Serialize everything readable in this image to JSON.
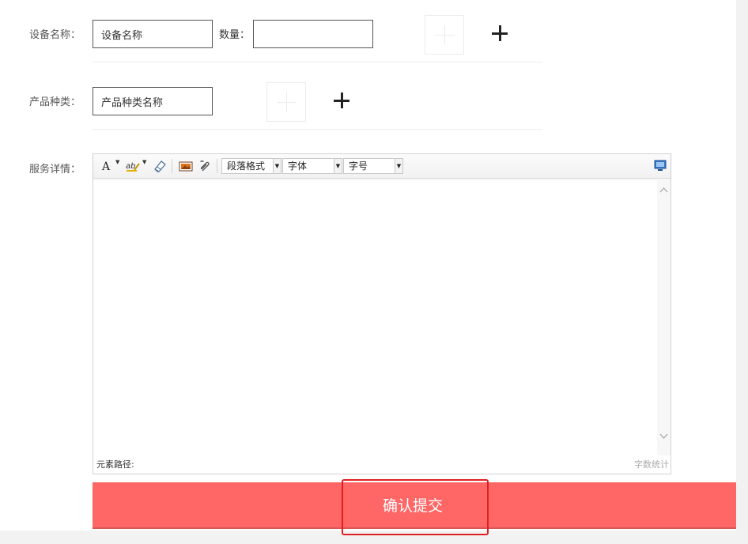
{
  "form": {
    "device_label": "设备名称：",
    "device_value": "设备名称",
    "quantity_label": "数量：",
    "quantity_value": "",
    "product_label": "产品种类：",
    "product_value": "产品种类名称",
    "service_label": "服务详情："
  },
  "editor": {
    "toolbar": {
      "font_color_icon": "font-color-icon",
      "highlight_icon": "highlight-color-icon",
      "eraser_icon": "eraser-icon",
      "image_icon": "image-icon",
      "attachment_icon": "attachment-icon",
      "paragraph_format": "段落格式",
      "font_family": "字体",
      "font_size": "字号",
      "fullscreen_icon": "fullscreen-icon"
    },
    "content": "",
    "path_label": "元素路径:",
    "word_count_label": "字数统计"
  },
  "submit_label": "确认提交",
  "colors": {
    "submit_background": "#ff6666",
    "highlight_border": "#e02020"
  }
}
